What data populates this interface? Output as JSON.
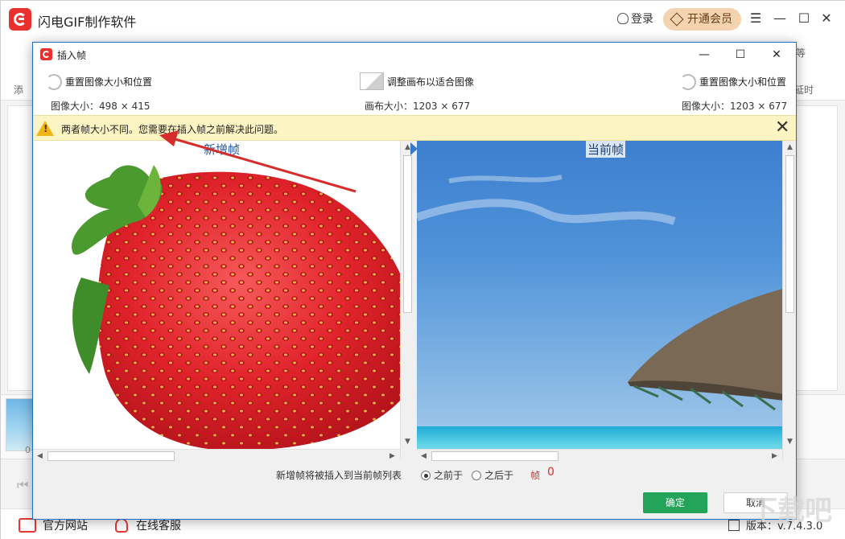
{
  "app": {
    "title": "闪电GIF制作软件",
    "login_label": "登录",
    "vip_label": "开通会员",
    "toolbar_edge_top": "等",
    "toolbar_edge_label": "延时",
    "toolbar_left_label": "添",
    "thumb_index": "0",
    "status": {
      "website_label": "官方网站",
      "service_label": "在线客服",
      "version_label": "版本：v.7.4.3.0"
    }
  },
  "dialog": {
    "title": "插入帧",
    "left_info": {
      "action": "重置图像大小和位置",
      "size": "图像大小：498 × 415"
    },
    "center_info": {
      "action": "调整画布以适合图像",
      "size": "画布大小：1203 × 677"
    },
    "right_info": {
      "action": "重置图像大小和位置",
      "size": "图像大小：1203 × 677"
    },
    "warning": "两者帧大小不同。您需要在插入帧之前解决此问题。",
    "left_panel_label": "新增帧",
    "right_panel_label": "当前帧",
    "insert_text": "新增帧将被插入到当前帧列表",
    "option_before": "之前于",
    "option_after": "之后于",
    "frame_label": "帧",
    "frame_number": "0",
    "ok_label": "确定",
    "cancel_label": "取消"
  },
  "colors": {
    "accent_green": "#23a45a",
    "warning_bg": "#fdf4c4",
    "brand_red": "#e8312f",
    "annotation_red": "#d62c2c"
  }
}
